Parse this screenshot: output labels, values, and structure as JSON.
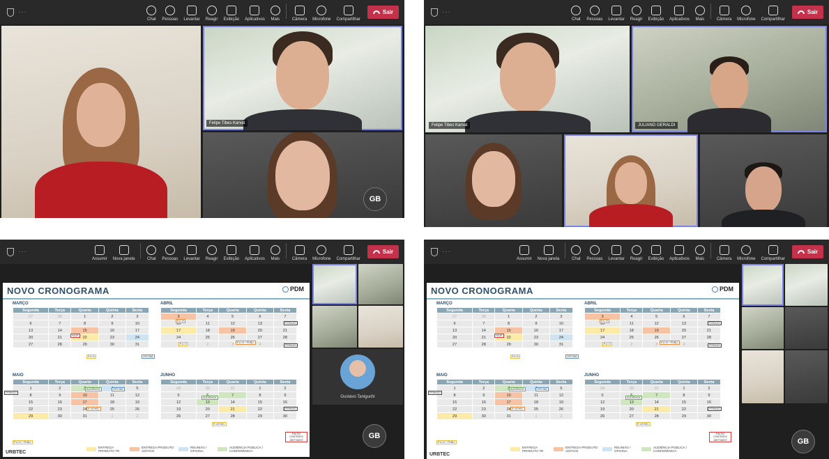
{
  "toolbar_full": [
    {
      "label": "Chat",
      "icon": "chat-icon"
    },
    {
      "label": "Pessoas",
      "icon": "people-icon"
    },
    {
      "label": "Levantar",
      "icon": "raise-hand-icon"
    },
    {
      "label": "Reagir",
      "icon": "react-icon"
    },
    {
      "label": "Exibição",
      "icon": "layout-icon"
    },
    {
      "label": "Aplicativos",
      "icon": "apps-icon"
    },
    {
      "label": "Mais",
      "icon": "more-icon"
    }
  ],
  "toolbar_extra": [
    {
      "label": "Assumir",
      "icon": "take-control-icon"
    },
    {
      "label": "Nova janela",
      "icon": "new-window-icon"
    }
  ],
  "toolbar_right": [
    {
      "label": "Câmera",
      "icon": "camera-off-icon"
    },
    {
      "label": "Microfone",
      "icon": "mic-off-icon"
    },
    {
      "label": "Compartilhar",
      "icon": "share-icon"
    }
  ],
  "leave_label": "Sair",
  "dots": "···",
  "names": {
    "felipe": "Felipe Tibes Karvat",
    "juliano": "JULIANO GERALDI",
    "gustavo": "Gustavo Taniguchi"
  },
  "initials": "GB",
  "slide": {
    "title": "NOVO CRONOGRAMA",
    "logo": "PDM",
    "footer": "URBTEC",
    "months": [
      "MARÇO",
      "ABRIL",
      "MAIO",
      "JUNHO"
    ],
    "weekdays": [
      "Segunda",
      "Terça",
      "Quarta",
      "Quinta",
      "Sexta"
    ],
    "marco": [
      [
        "27",
        "28",
        "1",
        "2",
        "3"
      ],
      [
        "6",
        "7",
        "8",
        "9",
        "10"
      ],
      [
        "13",
        "14",
        "15",
        "16",
        "17"
      ],
      [
        "20",
        "21",
        "22",
        "23",
        "24"
      ],
      [
        "27",
        "28",
        "29",
        "30",
        "31"
      ]
    ],
    "abril": [
      [
        "3",
        "4",
        "5",
        "6",
        "7"
      ],
      [
        "10",
        "11",
        "12",
        "13",
        "14"
      ],
      [
        "17",
        "18",
        "19",
        "20",
        "21"
      ],
      [
        "24",
        "25",
        "26",
        "27",
        "28"
      ],
      [
        "1",
        "2",
        "3",
        "4",
        "5"
      ]
    ],
    "maio": [
      [
        "1",
        "2",
        "3",
        "4",
        "5"
      ],
      [
        "8",
        "9",
        "10",
        "11",
        "12"
      ],
      [
        "15",
        "16",
        "17",
        "18",
        "19"
      ],
      [
        "22",
        "23",
        "24",
        "25",
        "26"
      ],
      [
        "29",
        "30",
        "31",
        "1",
        "2"
      ]
    ],
    "junho": [
      [
        "29",
        "30",
        "31",
        "1",
        "2"
      ],
      [
        "5",
        "6",
        "7",
        "8",
        "9"
      ],
      [
        "12",
        "13",
        "14",
        "15",
        "16"
      ],
      [
        "19",
        "20",
        "21",
        "22",
        "23"
      ],
      [
        "26",
        "27",
        "28",
        "29",
        "30"
      ]
    ],
    "notes": {
      "hoje": "HOJE",
      "feriado": "FERIADO",
      "pu_vi": "P.U.VI",
      "pu_vi_full": "P.U.VI + PUBLI.",
      "oficina": "OFICINA",
      "audiencia": "AUDIÊNCIA",
      "r_ativid": "R. ATIVID.",
      "fim": "FIM DO CONTRATO ADITIVADO"
    },
    "legend": [
      {
        "label": "ENTREGA PRODUTO TR",
        "color": "#fbeaa8"
      },
      {
        "label": "ENTREGA PRODUTO ADITIVO",
        "color": "#f6c4a5"
      },
      {
        "label": "REUNIÃO / OFICINA",
        "color": "#cfe3f3"
      },
      {
        "label": "AUDIÊNCIA PÚBLICA / CONFERÊNCIA",
        "color": "#cfe6c0"
      }
    ]
  }
}
